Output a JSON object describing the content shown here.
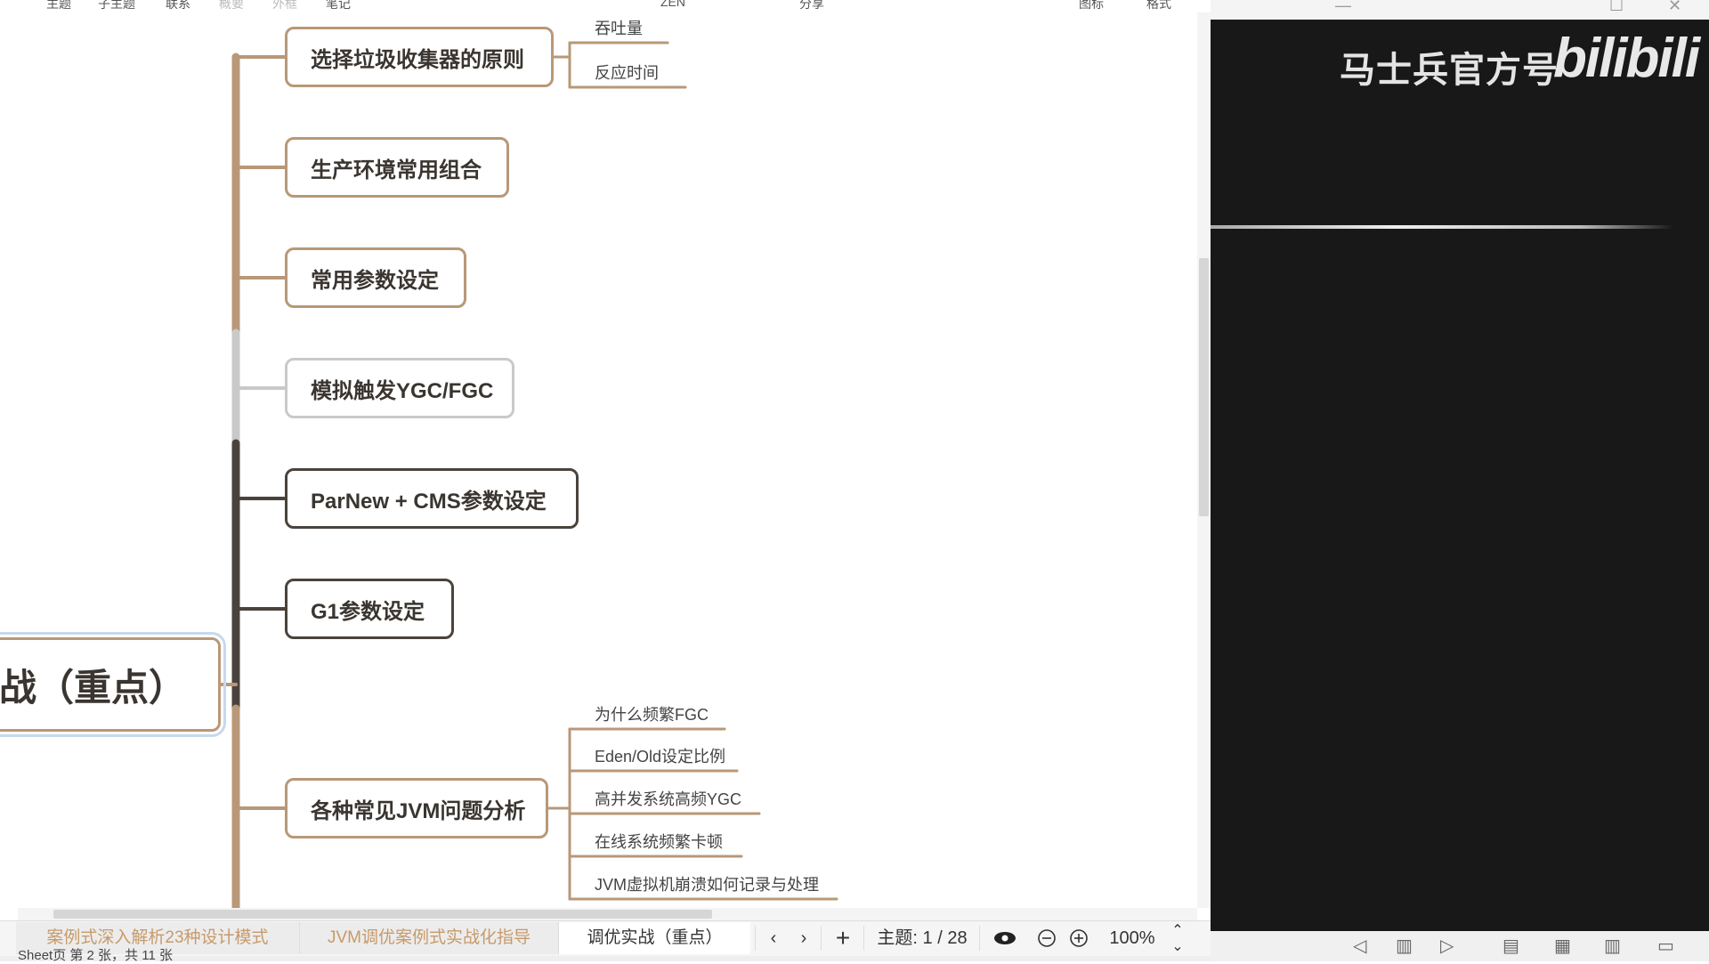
{
  "toolbar": {
    "items": [
      {
        "label": "主题",
        "disabled": false
      },
      {
        "label": "子主题",
        "disabled": false
      },
      {
        "label": "联系",
        "disabled": false
      },
      {
        "label": "概要",
        "disabled": true
      },
      {
        "label": "外框",
        "disabled": true
      },
      {
        "label": "笔记",
        "disabled": false
      },
      {
        "label": "ZEN",
        "disabled": false
      },
      {
        "label": "分享",
        "disabled": false
      },
      {
        "label": "图标",
        "disabled": false
      },
      {
        "label": "格式",
        "disabled": false
      }
    ]
  },
  "mindmap": {
    "root": "战（重点）",
    "topics": [
      {
        "label": "选择垃圾收集器的原则",
        "style": "brown",
        "children": [
          "吞吐量",
          "反应时间"
        ]
      },
      {
        "label": "生产环境常用组合",
        "style": "brown",
        "children": []
      },
      {
        "label": "常用参数设定",
        "style": "brown",
        "children": []
      },
      {
        "label": "模拟触发YGC/FGC",
        "style": "gray",
        "children": []
      },
      {
        "label": "ParNew + CMS参数设定",
        "style": "dark",
        "children": []
      },
      {
        "label": "G1参数设定",
        "style": "dark",
        "children": []
      },
      {
        "label": "各种常见JVM问题分析",
        "style": "brown",
        "children": [
          "为什么频繁FGC",
          "Eden/Old设定比例",
          "高并发系统高频YGC",
          "在线系统频繁卡顿",
          "JVM虚拟机崩溃如何记录与处理"
        ]
      }
    ],
    "colors": {
      "brown": "#b89878",
      "gray": "#c9c9c9",
      "dark": "#4a433d"
    }
  },
  "bottombar": {
    "tabs": [
      {
        "label": "案例式深入解析23种设计模式",
        "active": false
      },
      {
        "label": "JVM调优案例式实战化指导",
        "active": false
      },
      {
        "label": "调优实战（重点）",
        "active": true
      }
    ],
    "prev_icon": "chevron-left-icon",
    "next_icon": "chevron-right-icon",
    "add_label": "+",
    "topic_count": "主题: 1 / 28",
    "zoom": "100%",
    "status": "Sheet页 第 2 张，共 11 张"
  },
  "video": {
    "brand": "马士兵官方号",
    "logo": "bilibili"
  }
}
